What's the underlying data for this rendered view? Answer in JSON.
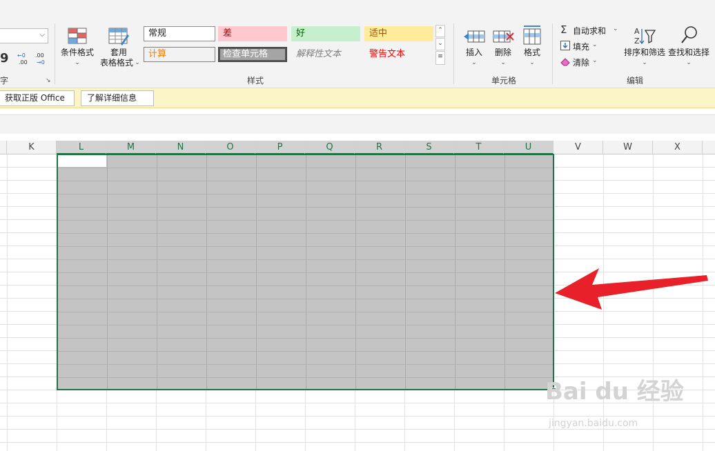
{
  "ribbon": {
    "number_group": {
      "label_fragment": "字",
      "dec_increase": "←0\n.00",
      "dec_decrease": ".00\n→0",
      "comma": "9"
    },
    "styles_group": {
      "conditional_format": "条件格式",
      "table_format_line1": "套用",
      "table_format_line2": "表格格式",
      "label": "样式",
      "gallery": [
        {
          "text": "常规",
          "bg": "#ffffff",
          "color": "#222222",
          "border": "#8c8c8c"
        },
        {
          "text": "差",
          "bg": "#ffc7ce",
          "color": "#9c0006",
          "border": "#ffc7ce"
        },
        {
          "text": "好",
          "bg": "#c6efce",
          "color": "#006100",
          "border": "#c6efce"
        },
        {
          "text": "适中",
          "bg": "#ffeb9c",
          "color": "#9c5700",
          "border": "#ffeb9c"
        },
        {
          "text": "计算",
          "bg": "#f2f2f2",
          "color": "#fa7d00",
          "border": "#7f7f7f"
        },
        {
          "text": "检查单元格",
          "bg": "#a5a5a5",
          "color": "#ffffff",
          "border": "#3f3f3f"
        },
        {
          "text": "解释性文本",
          "bg": "#f3f3f3",
          "color": "#7f7f7f",
          "border": "#f3f3f3"
        },
        {
          "text": "警告文本",
          "bg": "#f3f3f3",
          "color": "#ff0000",
          "border": "#f3f3f3"
        }
      ]
    },
    "cells_group": {
      "insert": "插入",
      "delete": "删除",
      "format": "格式",
      "label": "单元格"
    },
    "editing_group": {
      "autosum": "自动求和",
      "fill": "填充",
      "clear": "清除",
      "sort_filter": "排序和筛选",
      "find_select": "查找和选择",
      "label": "编辑"
    }
  },
  "infobar": {
    "get_office": "获取正版 Office",
    "learn_more": "了解详细信息"
  },
  "columns": [
    "K",
    "L",
    "M",
    "N",
    "O",
    "P",
    "Q",
    "R",
    "S",
    "T",
    "U",
    "V",
    "W",
    "X"
  ],
  "selected_columns": [
    "L",
    "M",
    "N",
    "O",
    "P",
    "Q",
    "R",
    "S",
    "T",
    "U"
  ],
  "watermark": {
    "main": "Bai du 经验",
    "sub": "jingyan.baidu.com"
  },
  "colors": {
    "accent": "#217346",
    "selection": "#c4c4c4",
    "arrow": "#e8202a"
  }
}
